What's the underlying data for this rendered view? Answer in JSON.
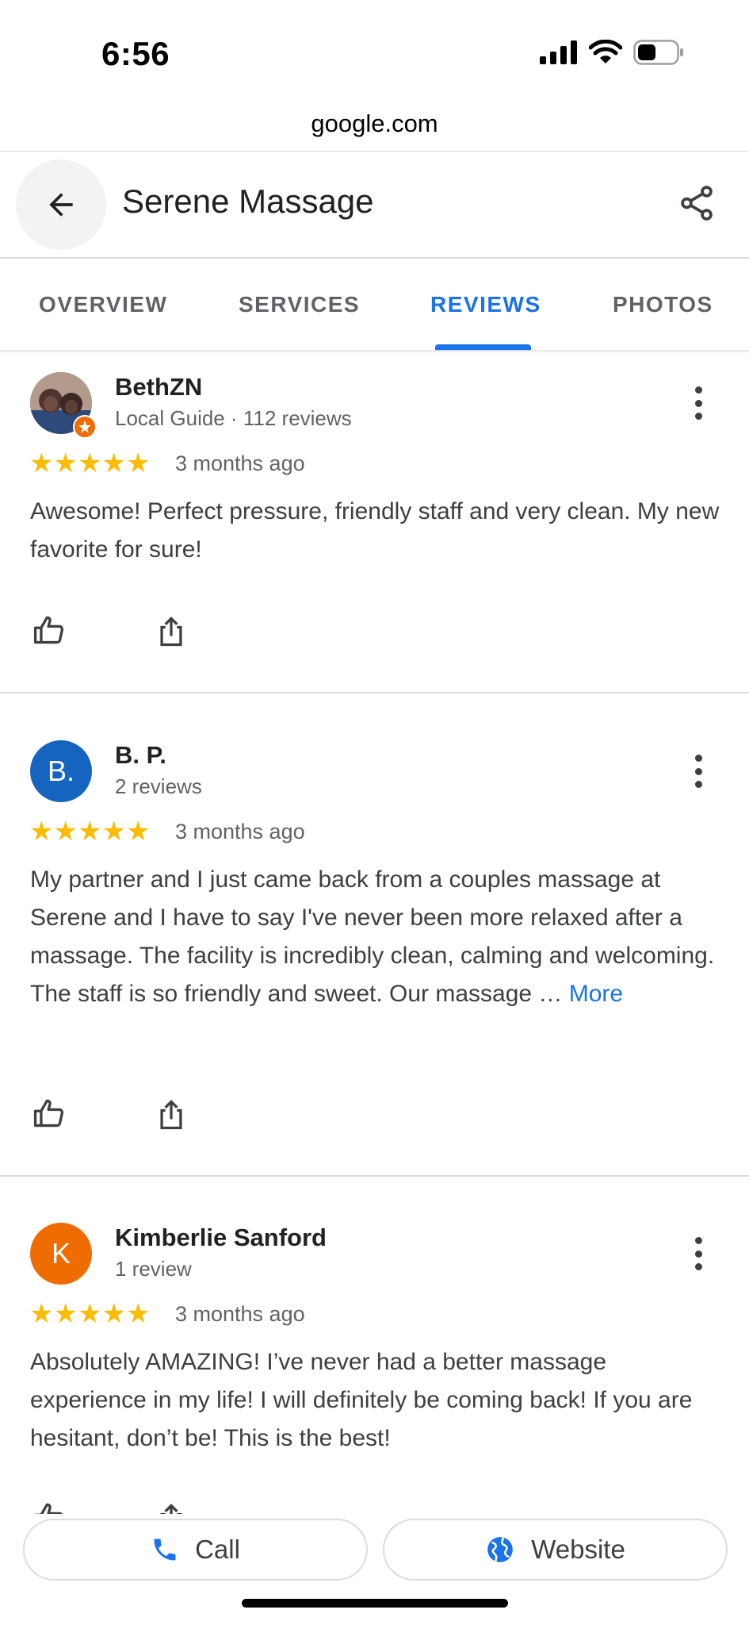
{
  "status_bar": {
    "time": "6:56"
  },
  "browser": {
    "url": "google.com"
  },
  "header": {
    "title": "Serene Massage"
  },
  "tabs": [
    {
      "label": "OVERVIEW",
      "active": false
    },
    {
      "label": "SERVICES",
      "active": false
    },
    {
      "label": "REVIEWS",
      "active": true
    },
    {
      "label": "PHOTOS",
      "active": false
    }
  ],
  "reviews": [
    {
      "name": "BethZN",
      "meta": "Local Guide · 112 reviews",
      "avatar_type": "photo",
      "rating": 5,
      "date": "3 months ago",
      "text": "Awesome! Perfect pressure, friendly staff and very clean. My new favorite for sure!",
      "more_label": ""
    },
    {
      "name": "B. P.",
      "meta": "2 reviews",
      "avatar_initial": "B.",
      "avatar_color": "#1565c0",
      "rating": 5,
      "date": "3 months ago",
      "text": "My partner and I just came back from a couples massage at Serene and I have to say I've never been more relaxed after a massage. The facility is incredibly clean, calming and welcoming. The staff is so friendly and sweet. Our massage … ",
      "more_label": "More"
    },
    {
      "name": "Kimberlie Sanford",
      "meta": "1 review",
      "avatar_initial": "K",
      "avatar_color": "#ef6c00",
      "rating": 5,
      "date": "3 months ago",
      "text": "Absolutely AMAZING! I’ve never had a better massage experience in my life! I will definitely be coming back! If you are hesitant, don’t be! This is the best!",
      "more_label": ""
    }
  ],
  "actions": {
    "call_label": "Call",
    "website_label": "Website"
  },
  "colors": {
    "accent": "#1a73e8",
    "star": "#fbbc04"
  },
  "icons": [
    "back-arrow-icon",
    "share-icon",
    "more-vert-icon",
    "star-icon",
    "thumb-up-icon",
    "share-review-icon",
    "phone-icon",
    "globe-icon",
    "signal-icon",
    "wifi-icon",
    "battery-icon"
  ]
}
